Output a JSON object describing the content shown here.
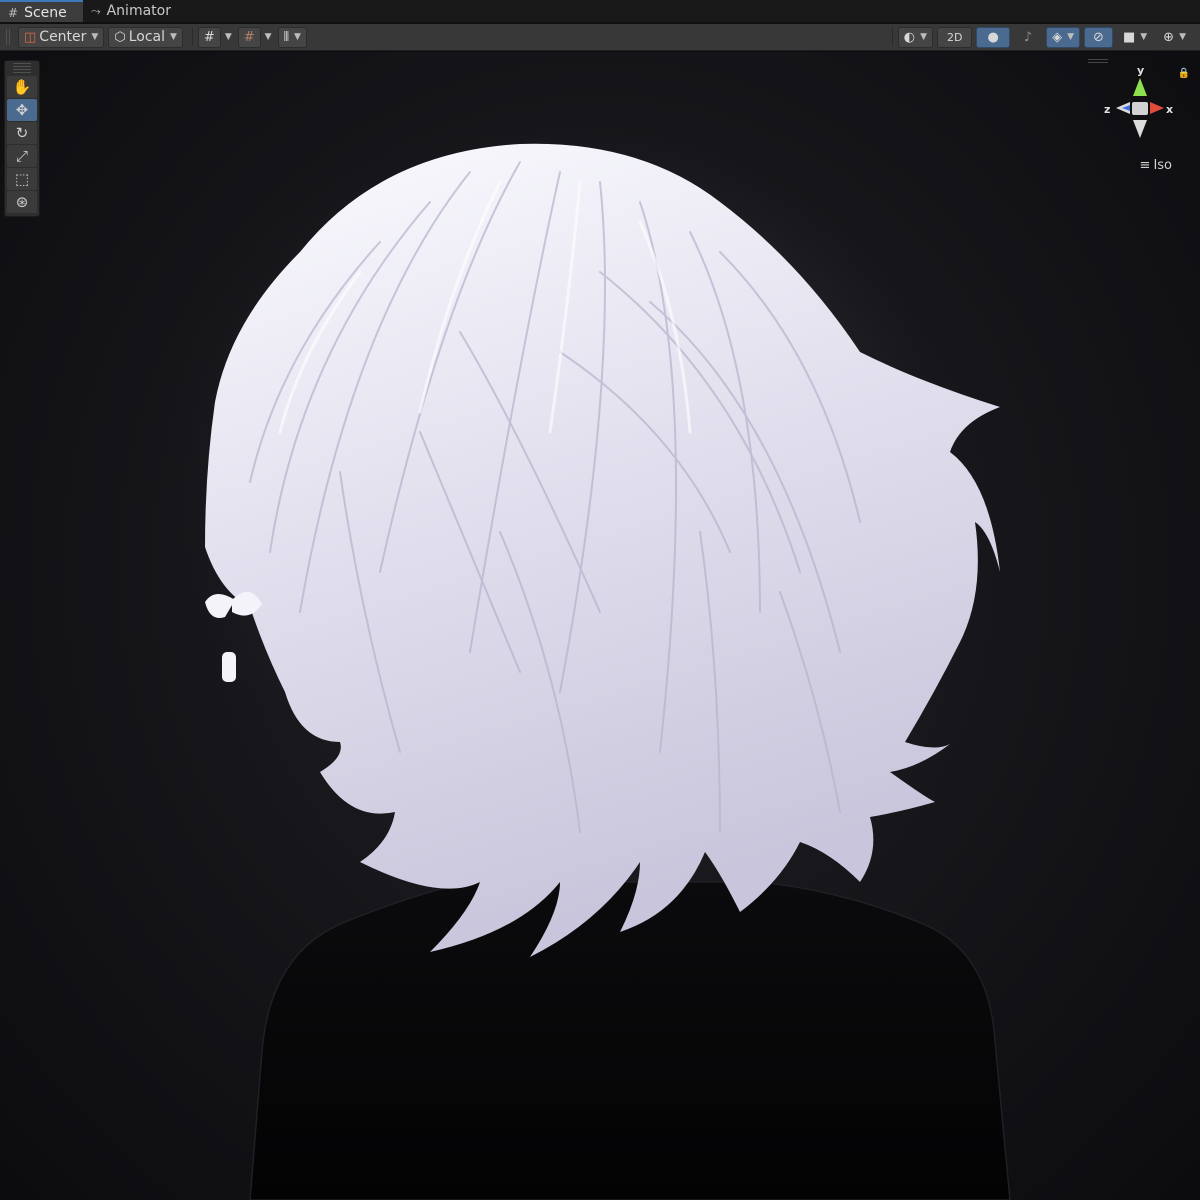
{
  "tabs": [
    {
      "label": "Scene",
      "icon": "grid-icon",
      "active": true
    },
    {
      "label": "Animator",
      "icon": "animator-icon",
      "active": false
    }
  ],
  "toolbar": {
    "pivot_label": "Center",
    "space_label": "Local",
    "mode_2d_label": "2D"
  },
  "gizmo": {
    "axis_y": "y",
    "axis_x": "x",
    "axis_z": "z",
    "projection_label": "Iso",
    "colors": {
      "y": "#8ee04e",
      "x": "#e24a3a",
      "z": "#3f6fe0"
    }
  },
  "tools": [
    "hand-tool",
    "move-tool",
    "rotate-tool",
    "scale-tool",
    "rect-tool",
    "transform-tool"
  ],
  "colors": {
    "accent": "#3a79bb",
    "active_button": "#4a6a8f",
    "background": "#0e0e11",
    "hair": "#e6e4ee"
  }
}
